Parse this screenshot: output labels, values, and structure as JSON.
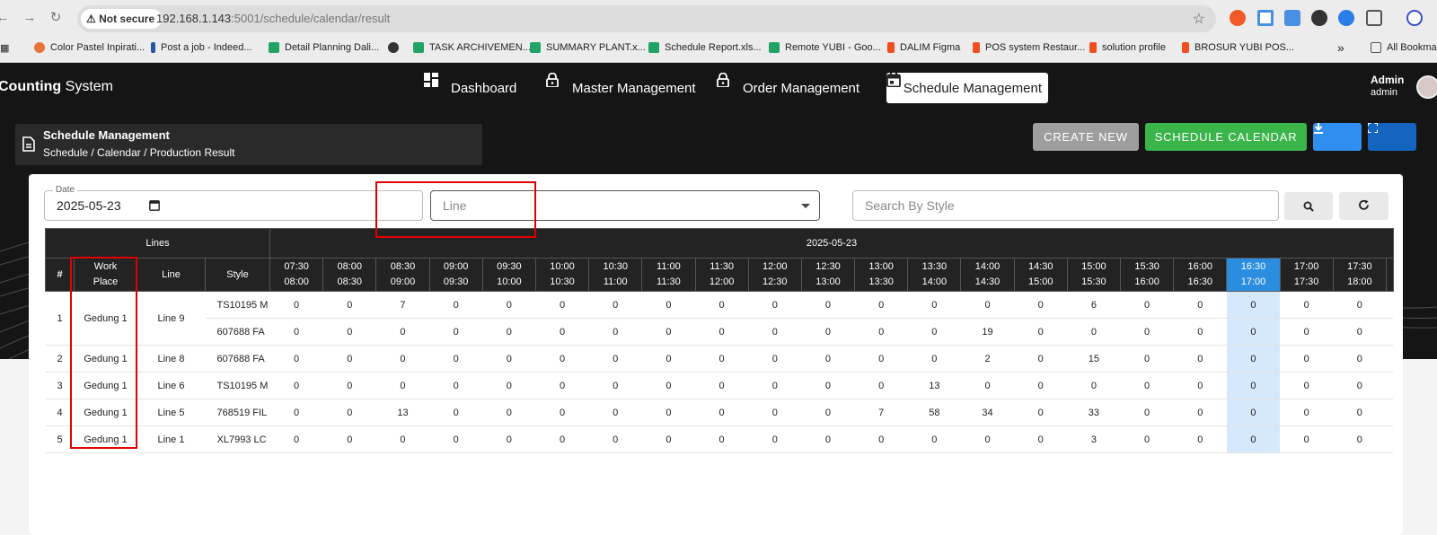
{
  "browser": {
    "secure_label": "Not secure",
    "url_host": "192.168.1.143",
    "url_rest": ":5001/schedule/calendar/result",
    "bookmarks": [
      {
        "label": "Color Pastel Inpirati...",
        "color": "#e8743b"
      },
      {
        "label": "Post a job - Indeed...",
        "color": "#2557a7"
      },
      {
        "label": "Detail Planning Dali...",
        "color": "#21a366"
      },
      {
        "label": "",
        "color": "#333333"
      },
      {
        "label": "TASK ARCHIVEMEN...",
        "color": "#21a366"
      },
      {
        "label": "SUMMARY PLANT.x...",
        "color": "#21a366"
      },
      {
        "label": "Schedule Report.xls...",
        "color": "#21a366"
      },
      {
        "label": "Remote YUBI - Goo...",
        "color": "#21a366"
      },
      {
        "label": "DALIM Figma",
        "color": "#f24e1e"
      },
      {
        "label": "POS system Restaur...",
        "color": "#f24e1e"
      },
      {
        "label": "solution profile",
        "color": "#f24e1e"
      },
      {
        "label": "BROSUR YUBI POS...",
        "color": "#f24e1e"
      }
    ],
    "all_bookmarks": "All Bookma"
  },
  "header": {
    "brand_bold": "Counting",
    "brand_rest": " System",
    "nav": [
      {
        "label": "Dashboard",
        "icon": "dashboard-icon"
      },
      {
        "label": "Master Management",
        "icon": "lock-icon"
      },
      {
        "label": "Order Management",
        "icon": "lock-icon"
      },
      {
        "label": "Schedule Management",
        "icon": "calendar-icon"
      }
    ],
    "user_name": "Admin",
    "user_role": "admin"
  },
  "page": {
    "title": "Schedule Management",
    "breadcrumb": "Schedule / Calendar / Production Result"
  },
  "actions": {
    "create_new": "CREATE NEW",
    "schedule_calendar": "SCHEDULE CALENDAR",
    "download_icon": "download-icon",
    "fullscreen_icon": "fullscreen-icon"
  },
  "colors": {
    "create_new": "#9e9e9e",
    "schedule_calendar": "#3ab54a",
    "download": "#2f8ff0",
    "fullscreen": "#1565c0",
    "highlight_header": "#2b8de0",
    "highlight_cell": "#d6e8fb"
  },
  "filters": {
    "date_label": "Date",
    "date_value": "2025-05-23",
    "line_placeholder": "Line",
    "style_placeholder": "Search By Style"
  },
  "table": {
    "group_lines": "Lines",
    "group_date": "2025-05-23",
    "col_no": "#",
    "col_work_place_1": "Work",
    "col_work_place_2": "Place",
    "col_line": "Line",
    "col_style": "Style",
    "slots": [
      [
        "07:30",
        "08:00"
      ],
      [
        "08:00",
        "08:30"
      ],
      [
        "08:30",
        "09:00"
      ],
      [
        "09:00",
        "09:30"
      ],
      [
        "09:30",
        "10:00"
      ],
      [
        "10:00",
        "10:30"
      ],
      [
        "10:30",
        "11:00"
      ],
      [
        "11:00",
        "11:30"
      ],
      [
        "11:30",
        "12:00"
      ],
      [
        "12:00",
        "12:30"
      ],
      [
        "12:30",
        "13:00"
      ],
      [
        "13:00",
        "13:30"
      ],
      [
        "13:30",
        "14:00"
      ],
      [
        "14:00",
        "14:30"
      ],
      [
        "14:30",
        "15:00"
      ],
      [
        "15:00",
        "15:30"
      ],
      [
        "15:30",
        "16:00"
      ],
      [
        "16:00",
        "16:30"
      ],
      [
        "16:30",
        "17:00"
      ],
      [
        "17:00",
        "17:30"
      ],
      [
        "17:30",
        "18:00"
      ]
    ],
    "highlight_slot": 18,
    "groups": [
      {
        "no": "1",
        "work_place": "Gedung 1",
        "line": "Line 9",
        "styles": [
          {
            "style": "TS10195 M",
            "values": [
              "0",
              "0",
              "7",
              "0",
              "0",
              "0",
              "0",
              "0",
              "0",
              "0",
              "0",
              "0",
              "0",
              "0",
              "0",
              "6",
              "0",
              "0",
              "0",
              "0",
              "0"
            ]
          },
          {
            "style": "607688 FA",
            "values": [
              "0",
              "0",
              "0",
              "0",
              "0",
              "0",
              "0",
              "0",
              "0",
              "0",
              "0",
              "0",
              "0",
              "19",
              "0",
              "0",
              "0",
              "0",
              "0",
              "0",
              "0"
            ]
          }
        ]
      },
      {
        "no": "2",
        "work_place": "Gedung 1",
        "line": "Line 8",
        "styles": [
          {
            "style": "607688 FA",
            "values": [
              "0",
              "0",
              "0",
              "0",
              "0",
              "0",
              "0",
              "0",
              "0",
              "0",
              "0",
              "0",
              "0",
              "2",
              "0",
              "15",
              "0",
              "0",
              "0",
              "0",
              "0"
            ]
          }
        ]
      },
      {
        "no": "3",
        "work_place": "Gedung 1",
        "line": "Line 6",
        "styles": [
          {
            "style": "TS10195 M",
            "values": [
              "0",
              "0",
              "0",
              "0",
              "0",
              "0",
              "0",
              "0",
              "0",
              "0",
              "0",
              "0",
              "13",
              "0",
              "0",
              "0",
              "0",
              "0",
              "0",
              "0",
              "0"
            ]
          }
        ]
      },
      {
        "no": "4",
        "work_place": "Gedung 1",
        "line": "Line 5",
        "styles": [
          {
            "style": "768519 FIL",
            "values": [
              "0",
              "0",
              "13",
              "0",
              "0",
              "0",
              "0",
              "0",
              "0",
              "0",
              "0",
              "7",
              "58",
              "34",
              "0",
              "33",
              "0",
              "0",
              "0",
              "0",
              "0"
            ]
          }
        ]
      },
      {
        "no": "5",
        "work_place": "Gedung 1",
        "line": "Line 1",
        "styles": [
          {
            "style": "XL7993 LC",
            "values": [
              "0",
              "0",
              "0",
              "0",
              "0",
              "0",
              "0",
              "0",
              "0",
              "0",
              "0",
              "0",
              "0",
              "0",
              "0",
              "3",
              "0",
              "0",
              "0",
              "0",
              "0"
            ]
          }
        ]
      }
    ]
  }
}
